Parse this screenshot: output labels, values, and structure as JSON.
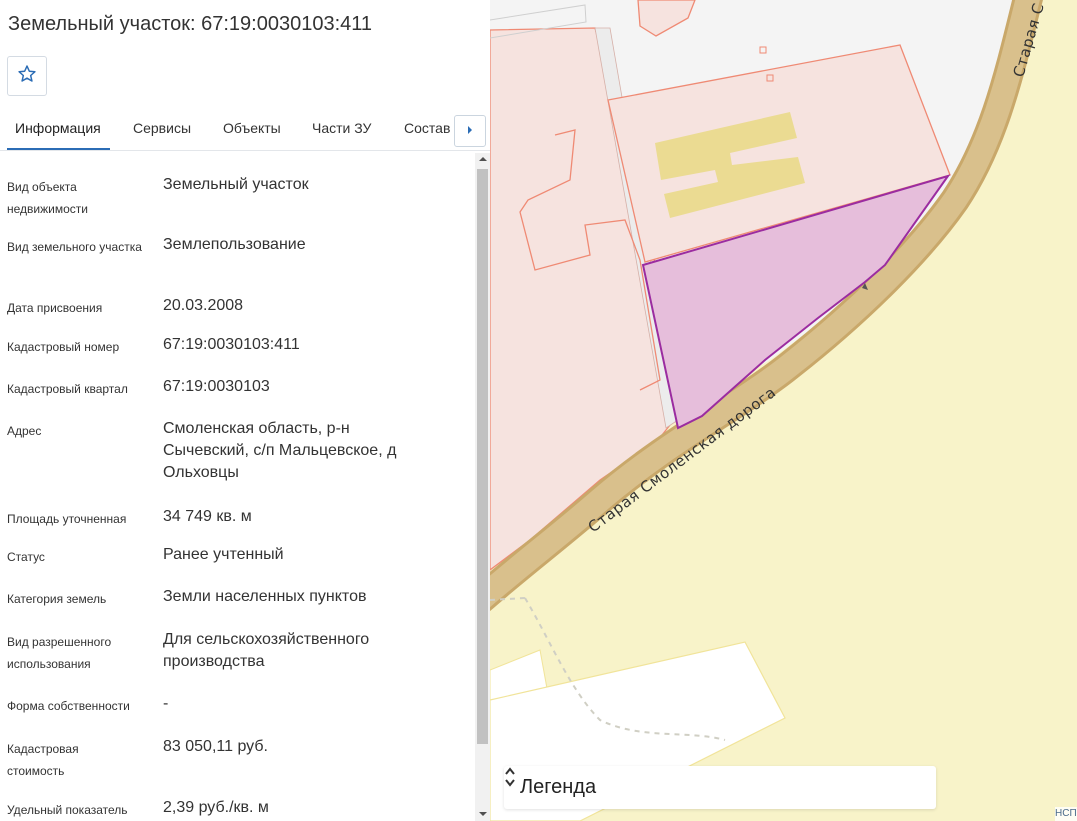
{
  "panel": {
    "title": "Земельный участок: 67:19:0030103:411",
    "favorite_icon": "star-outline-icon",
    "tabs": [
      {
        "label": "Информация",
        "active": true
      },
      {
        "label": "Сервисы"
      },
      {
        "label": "Объекты"
      },
      {
        "label": "Части ЗУ"
      },
      {
        "label": "Состав"
      }
    ],
    "tabs_next_icon": "caret-right-icon",
    "properties": [
      {
        "label": "Вид объекта недвижимости",
        "value": "Земельный участок"
      },
      {
        "label": "Вид земельного участка",
        "value": "Землепользование"
      },
      {
        "label": "Дата присвоения",
        "value": "20.03.2008"
      },
      {
        "label": "Кадастровый номер",
        "value": "67:19:0030103:411"
      },
      {
        "label": "Кадастровый квартал",
        "value": "67:19:0030103"
      },
      {
        "label": "Адрес",
        "value": "Смоленская область, р-н Сычевский, с/п Мальцевское, д Ольховцы"
      },
      {
        "label": "Площадь уточненная",
        "value": "34 749 кв. м"
      },
      {
        "label": "Статус",
        "value": "Ранее учтенный"
      },
      {
        "label": "Категория земель",
        "value": "Земли населенных пунктов"
      },
      {
        "label": "Вид разрешенного использования",
        "value": "Для сельскохозяйственного производства"
      },
      {
        "label": "Форма собственности",
        "value": "-"
      },
      {
        "label": "Кадастровая стоимость",
        "value": "83 050,11 руб."
      },
      {
        "label": "Удельный показатель",
        "value": "2,39 руб./кв. м"
      }
    ]
  },
  "map": {
    "road_label_main": "Старая Смоленская дорога",
    "road_label_top": "Старая С",
    "legend_label": "Легенда",
    "legend_toggle_icon": "chevron-up-down-icon",
    "attribution": "НСП",
    "colors": {
      "background": "#f8f3c9",
      "parcel_fill": "#f6e3df",
      "parcel_stroke": "#ef8a74",
      "selected_fill": "#e6bedb",
      "selected_stroke": "#9b2ca0",
      "road": "#d9c08c",
      "building": "#ebdb92"
    }
  }
}
